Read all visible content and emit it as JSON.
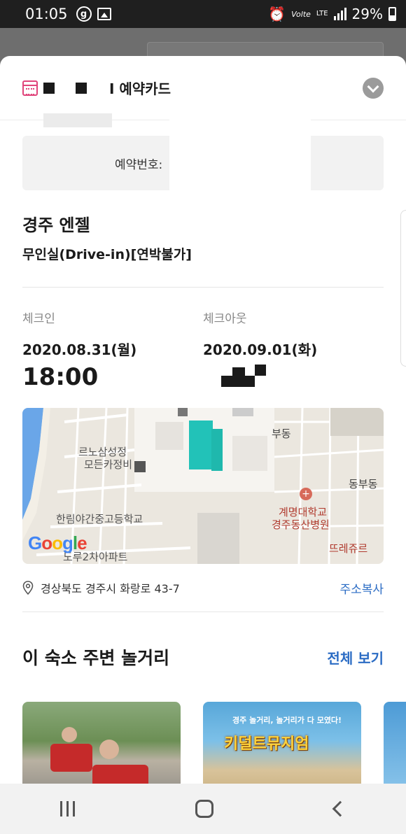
{
  "status_bar": {
    "time": "01:05",
    "volte_label": "Volte",
    "lte_label": "LTE",
    "battery_percent": "29%"
  },
  "header": {
    "title": "예약카드",
    "title_visible": "Ⅰ 예약카드"
  },
  "booking": {
    "label": "예약번호:"
  },
  "hotel": {
    "name": "경주 엔젤",
    "room_type": "무인실(Drive-in)[연박불가]"
  },
  "checkin": {
    "label": "체크인",
    "date": "2020.08.31(월)",
    "time": "18:00"
  },
  "checkout": {
    "label": "체크아웃",
    "date": "2020.09.01(화)"
  },
  "map": {
    "labels": {
      "church": "르노삼성정",
      "church2": "모든카정비",
      "school": "한림야간중고등학교",
      "apt": "도루2차아파트",
      "hospital1": "계명대학교",
      "hospital2": "경주동산병원",
      "bakery": "뜨레쥬르",
      "dong1": "부동",
      "dong2": "동부동"
    },
    "logo": "Google"
  },
  "address": {
    "text": "경상북도 경주시 화랑로 43-7",
    "copy_label": "주소복사"
  },
  "nearby": {
    "title": "이 숙소 주변 놀거리",
    "see_all": "전체 보기",
    "cards": [
      {
        "title": ""
      },
      {
        "subtitle": "경주 놀거리, 놀거리가 다 모였다!",
        "title": "키덜트뮤지엄"
      },
      {
        "title": ""
      }
    ]
  },
  "colors": {
    "accent_pink": "#e0457b",
    "link_blue": "#2b6cc4"
  }
}
